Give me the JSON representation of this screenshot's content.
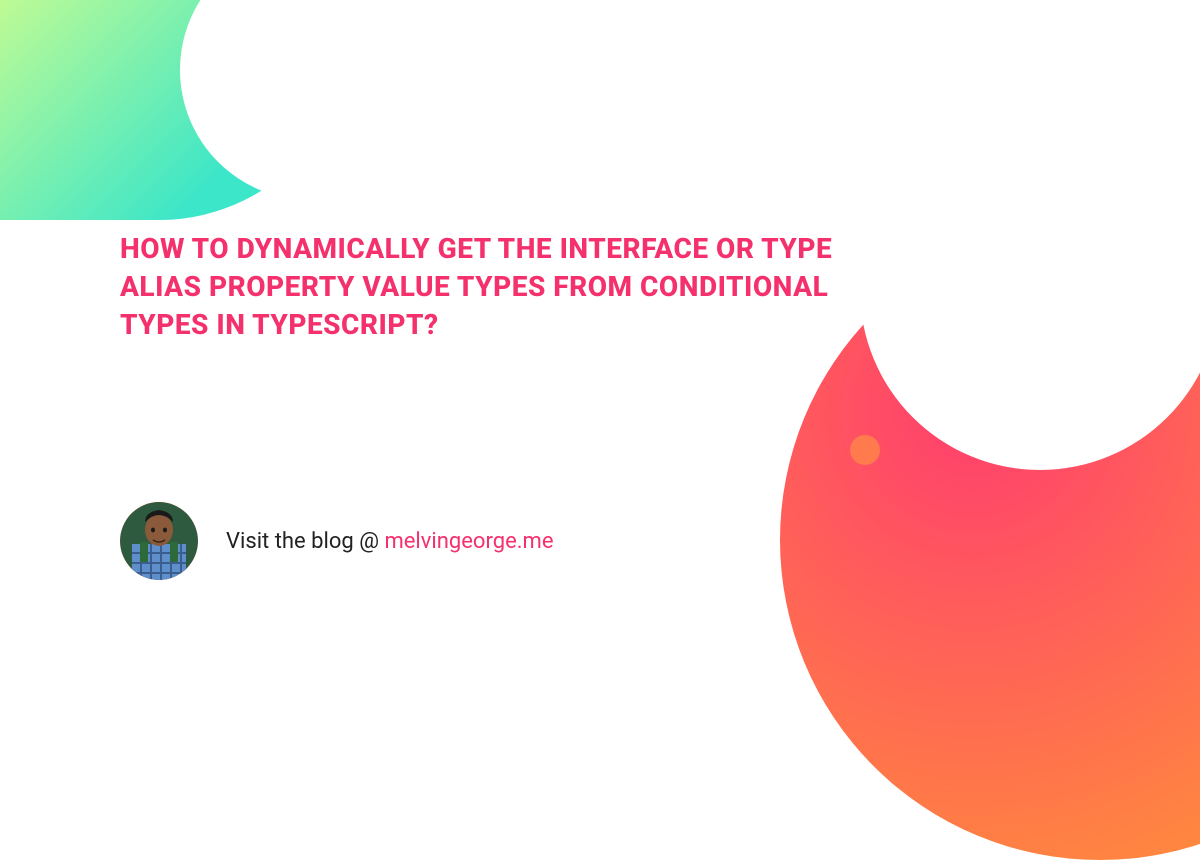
{
  "headline": "HOW TO DYNAMICALLY GET THE INTERFACE OR TYPE ALIAS PROPERTY VALUE TYPES FROM CONDITIONAL TYPES IN TYPESCRIPT?",
  "footer": {
    "visit_prefix": "Visit the blog @ ",
    "visit_link": "melvingeorge.me"
  }
}
